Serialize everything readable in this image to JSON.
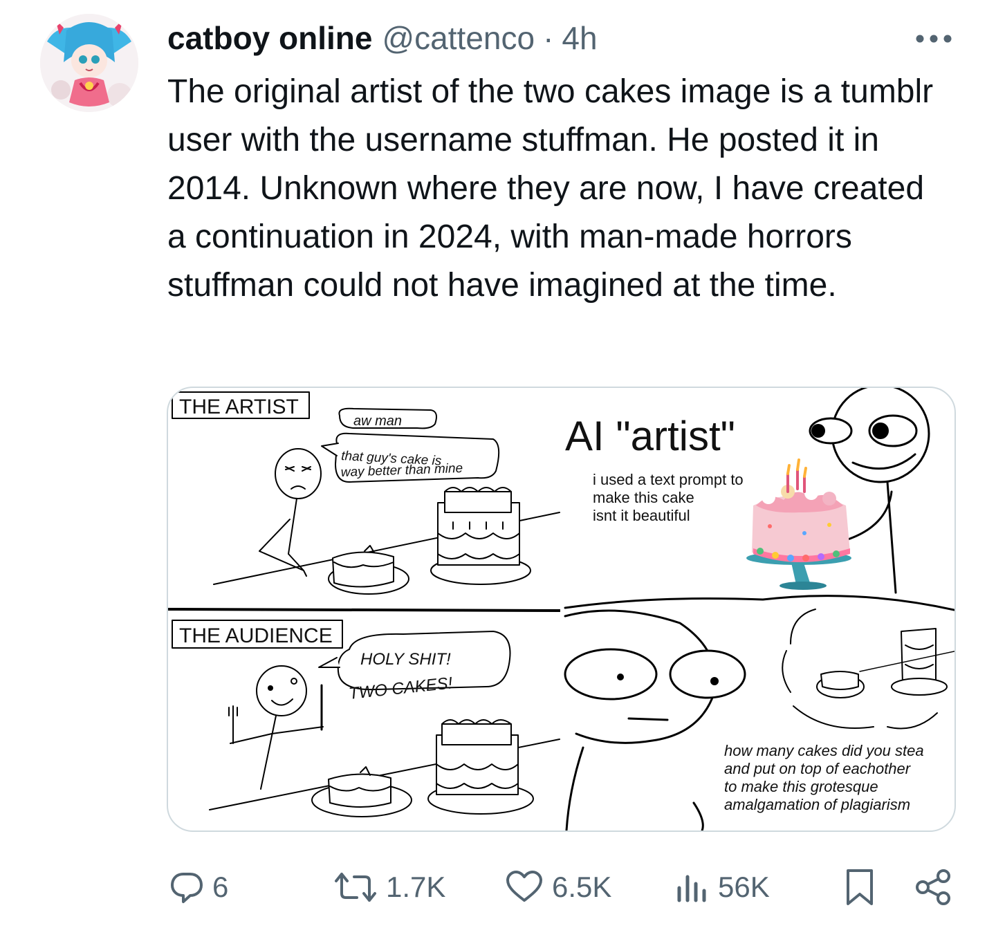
{
  "tweet": {
    "display_name": "catboy online",
    "handle": "@cattenco",
    "separator": "·",
    "time": "4h",
    "text": "The original artist of the two cakes image is a tumblr user with the username stuffman. He posted it in 2014. Unknown where they are now, I have created a continuation in 2024, with man-made horrors stuffman could not have imagined at the time."
  },
  "comic": {
    "panel_artist_label": "THE ARTIST",
    "bubble_artist_line1": "aw   man",
    "bubble_artist_line2": "that guy's cake is",
    "bubble_artist_line3": "way better than mine",
    "panel_audience_label": "THE AUDIENCE",
    "bubble_audience_line1": "HOLY SHIT!",
    "bubble_audience_line2": "TWO CAKES!",
    "ai_title": "AI \"artist\"",
    "ai_caption_line1": "i used a text prompt to",
    "ai_caption_line2": "make this cake",
    "ai_caption_line3": "isnt it beautiful",
    "reply_line1": "how many cakes did you stea",
    "reply_line2": "and put on top of eachother",
    "reply_line3": "to make this grotesque",
    "reply_line4": "amalgamation of plagiarism"
  },
  "actions": {
    "replies": "6",
    "reposts": "1.7K",
    "likes": "6.5K",
    "views": "56K"
  },
  "icons": {
    "more": "more-icon",
    "reply": "reply-icon",
    "repost": "repost-icon",
    "like": "heart-icon",
    "views": "views-icon",
    "bookmark": "bookmark-icon",
    "share": "share-icon"
  },
  "colors": {
    "text": "#0f1419",
    "secondary": "#536471",
    "border": "#cfd9de",
    "avatar_hair": "#3fb6e6",
    "avatar_bow": "#e8436d"
  }
}
